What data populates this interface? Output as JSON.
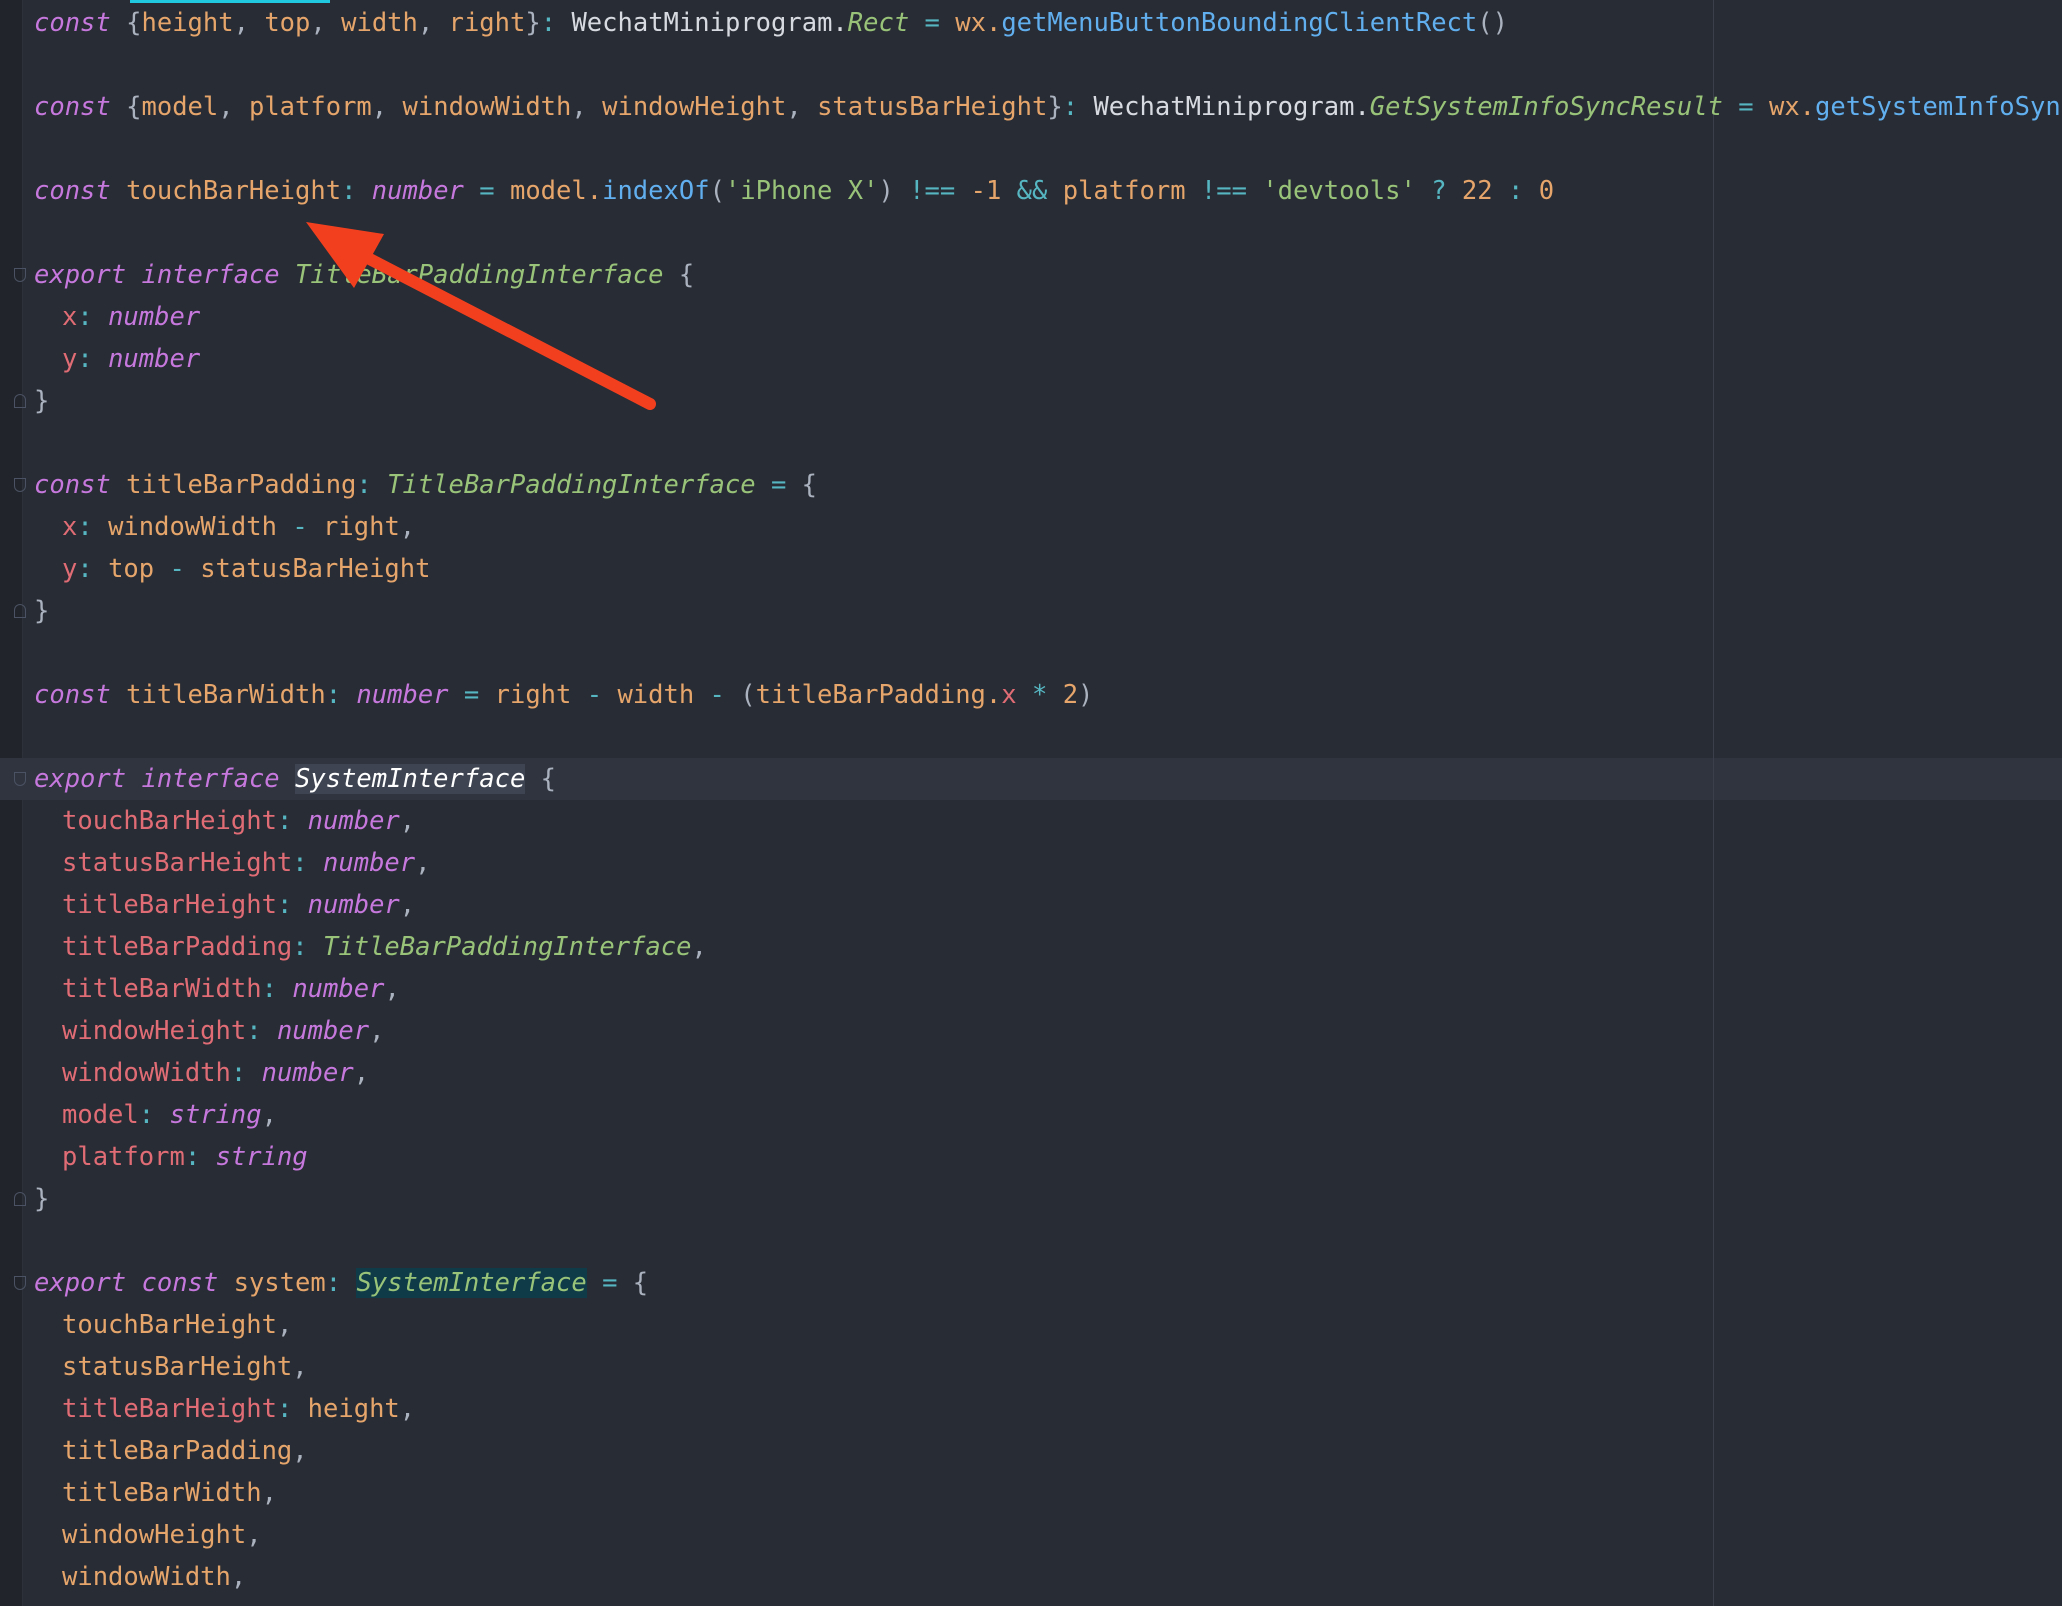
{
  "editor": {
    "colors": {
      "background": "#282c34",
      "annotation_arrow": "#f2401f",
      "scroll_tab": "#20c9e0"
    },
    "annotation_icon": "arrow-annotation-icon",
    "lines": [
      {
        "row": 0,
        "indent": 0,
        "tokens": [
          {
            "t": "const",
            "c": "kw"
          },
          {
            "t": " {",
            "c": "pun"
          },
          {
            "t": "height",
            "c": "var"
          },
          {
            "t": ", ",
            "c": "pun"
          },
          {
            "t": "top",
            "c": "var"
          },
          {
            "t": ", ",
            "c": "pun"
          },
          {
            "t": "width",
            "c": "var"
          },
          {
            "t": ", ",
            "c": "pun"
          },
          {
            "t": "right",
            "c": "var"
          },
          {
            "t": "}",
            "c": "pun"
          },
          {
            "t": ": ",
            "c": "op"
          },
          {
            "t": "WechatMiniprogram.",
            "c": "plain"
          },
          {
            "t": "Rect",
            "c": "cls"
          },
          {
            "t": " = ",
            "c": "op"
          },
          {
            "t": "wx.",
            "c": "var"
          },
          {
            "t": "getMenuButtonBoundingClientRect",
            "c": "fn"
          },
          {
            "t": "()",
            "c": "pun"
          }
        ]
      },
      {
        "row": 2,
        "indent": 0,
        "tokens": [
          {
            "t": "const",
            "c": "kw"
          },
          {
            "t": " {",
            "c": "pun"
          },
          {
            "t": "model",
            "c": "var"
          },
          {
            "t": ", ",
            "c": "pun"
          },
          {
            "t": "platform",
            "c": "var"
          },
          {
            "t": ", ",
            "c": "pun"
          },
          {
            "t": "windowWidth",
            "c": "var"
          },
          {
            "t": ", ",
            "c": "pun"
          },
          {
            "t": "windowHeight",
            "c": "var"
          },
          {
            "t": ", ",
            "c": "pun"
          },
          {
            "t": "statusBarHeight",
            "c": "var"
          },
          {
            "t": "}",
            "c": "pun"
          },
          {
            "t": ": ",
            "c": "op"
          },
          {
            "t": "WechatMiniprogram.",
            "c": "plain"
          },
          {
            "t": "GetSystemInfoSyncResult",
            "c": "cls"
          },
          {
            "t": " = ",
            "c": "op"
          },
          {
            "t": "wx.",
            "c": "var"
          },
          {
            "t": "getSystemInfoSync",
            "c": "fn"
          },
          {
            "t": "()",
            "c": "pun"
          }
        ]
      },
      {
        "row": 4,
        "indent": 0,
        "tokens": [
          {
            "t": "const",
            "c": "kw"
          },
          {
            "t": " touchBarHeight",
            "c": "var"
          },
          {
            "t": ": ",
            "c": "op"
          },
          {
            "t": "number",
            "c": "typ"
          },
          {
            "t": " = ",
            "c": "op"
          },
          {
            "t": "model.",
            "c": "var"
          },
          {
            "t": "indexOf",
            "c": "fn"
          },
          {
            "t": "(",
            "c": "pun"
          },
          {
            "t": "'iPhone X'",
            "c": "str"
          },
          {
            "t": ") ",
            "c": "pun"
          },
          {
            "t": "!==",
            "c": "op"
          },
          {
            "t": " -1 ",
            "c": "num"
          },
          {
            "t": "&&",
            "c": "op"
          },
          {
            "t": " platform ",
            "c": "var"
          },
          {
            "t": "!==",
            "c": "op"
          },
          {
            "t": " ",
            "c": "pun"
          },
          {
            "t": "'devtools'",
            "c": "str"
          },
          {
            "t": " ? ",
            "c": "op"
          },
          {
            "t": "22",
            "c": "num"
          },
          {
            "t": " : ",
            "c": "op"
          },
          {
            "t": "0",
            "c": "num"
          }
        ]
      },
      {
        "row": 6,
        "indent": 0,
        "tokens": [
          {
            "t": "export",
            "c": "kw"
          },
          {
            "t": " ",
            "c": "pun"
          },
          {
            "t": "interface",
            "c": "kw"
          },
          {
            "t": " ",
            "c": "pun"
          },
          {
            "t": "TitleBarPaddingInterface",
            "c": "cls"
          },
          {
            "t": " {",
            "c": "pun"
          }
        ]
      },
      {
        "row": 7,
        "indent": 1,
        "tokens": [
          {
            "t": "x",
            "c": "prop"
          },
          {
            "t": ": ",
            "c": "op"
          },
          {
            "t": "number",
            "c": "typ"
          }
        ]
      },
      {
        "row": 8,
        "indent": 1,
        "tokens": [
          {
            "t": "y",
            "c": "prop"
          },
          {
            "t": ": ",
            "c": "op"
          },
          {
            "t": "number",
            "c": "typ"
          }
        ]
      },
      {
        "row": 9,
        "indent": 0,
        "tokens": [
          {
            "t": "}",
            "c": "pun"
          }
        ]
      },
      {
        "row": 11,
        "indent": 0,
        "tokens": [
          {
            "t": "const",
            "c": "kw"
          },
          {
            "t": " titleBarPadding",
            "c": "var"
          },
          {
            "t": ": ",
            "c": "op"
          },
          {
            "t": "TitleBarPaddingInterface",
            "c": "cls"
          },
          {
            "t": " = ",
            "c": "op"
          },
          {
            "t": "{",
            "c": "pun"
          }
        ]
      },
      {
        "row": 12,
        "indent": 1,
        "tokens": [
          {
            "t": "x",
            "c": "prop"
          },
          {
            "t": ": ",
            "c": "op"
          },
          {
            "t": "windowWidth",
            "c": "var"
          },
          {
            "t": " - ",
            "c": "op"
          },
          {
            "t": "right",
            "c": "var"
          },
          {
            "t": ",",
            "c": "pun"
          }
        ]
      },
      {
        "row": 13,
        "indent": 1,
        "tokens": [
          {
            "t": "y",
            "c": "prop"
          },
          {
            "t": ": ",
            "c": "op"
          },
          {
            "t": "top",
            "c": "var"
          },
          {
            "t": " - ",
            "c": "op"
          },
          {
            "t": "statusBarHeight",
            "c": "var"
          }
        ]
      },
      {
        "row": 14,
        "indent": 0,
        "tokens": [
          {
            "t": "}",
            "c": "pun"
          }
        ]
      },
      {
        "row": 16,
        "indent": 0,
        "tokens": [
          {
            "t": "const",
            "c": "kw"
          },
          {
            "t": " titleBarWidth",
            "c": "var"
          },
          {
            "t": ": ",
            "c": "op"
          },
          {
            "t": "number",
            "c": "typ"
          },
          {
            "t": " = ",
            "c": "op"
          },
          {
            "t": "right",
            "c": "var"
          },
          {
            "t": " - ",
            "c": "op"
          },
          {
            "t": "width",
            "c": "var"
          },
          {
            "t": " - ",
            "c": "op"
          },
          {
            "t": "(",
            "c": "pun"
          },
          {
            "t": "titleBarPadding.",
            "c": "var"
          },
          {
            "t": "x",
            "c": "prop"
          },
          {
            "t": " * ",
            "c": "op"
          },
          {
            "t": "2",
            "c": "num"
          },
          {
            "t": ")",
            "c": "pun"
          }
        ]
      },
      {
        "row": 18,
        "indent": 0,
        "tokens": [
          {
            "t": "export",
            "c": "kw"
          },
          {
            "t": " ",
            "c": "pun"
          },
          {
            "t": "interface",
            "c": "kw"
          },
          {
            "t": " ",
            "c": "pun"
          },
          {
            "t": "SystemInterface",
            "c": "hl-sel"
          },
          {
            "t": " {",
            "c": "pun"
          }
        ]
      },
      {
        "row": 19,
        "indent": 1,
        "tokens": [
          {
            "t": "touchBarHeight",
            "c": "prop"
          },
          {
            "t": ": ",
            "c": "op"
          },
          {
            "t": "number",
            "c": "typ"
          },
          {
            "t": ",",
            "c": "pun"
          }
        ]
      },
      {
        "row": 20,
        "indent": 1,
        "tokens": [
          {
            "t": "statusBarHeight",
            "c": "prop"
          },
          {
            "t": ": ",
            "c": "op"
          },
          {
            "t": "number",
            "c": "typ"
          },
          {
            "t": ",",
            "c": "pun"
          }
        ]
      },
      {
        "row": 21,
        "indent": 1,
        "tokens": [
          {
            "t": "titleBarHeight",
            "c": "prop"
          },
          {
            "t": ": ",
            "c": "op"
          },
          {
            "t": "number",
            "c": "typ"
          },
          {
            "t": ",",
            "c": "pun"
          }
        ]
      },
      {
        "row": 22,
        "indent": 1,
        "tokens": [
          {
            "t": "titleBarPadding",
            "c": "prop"
          },
          {
            "t": ": ",
            "c": "op"
          },
          {
            "t": "TitleBarPaddingInterface",
            "c": "cls"
          },
          {
            "t": ",",
            "c": "pun"
          }
        ]
      },
      {
        "row": 23,
        "indent": 1,
        "tokens": [
          {
            "t": "titleBarWidth",
            "c": "prop"
          },
          {
            "t": ": ",
            "c": "op"
          },
          {
            "t": "number",
            "c": "typ"
          },
          {
            "t": ",",
            "c": "pun"
          }
        ]
      },
      {
        "row": 24,
        "indent": 1,
        "tokens": [
          {
            "t": "windowHeight",
            "c": "prop"
          },
          {
            "t": ": ",
            "c": "op"
          },
          {
            "t": "number",
            "c": "typ"
          },
          {
            "t": ",",
            "c": "pun"
          }
        ]
      },
      {
        "row": 25,
        "indent": 1,
        "tokens": [
          {
            "t": "windowWidth",
            "c": "prop"
          },
          {
            "t": ": ",
            "c": "op"
          },
          {
            "t": "number",
            "c": "typ"
          },
          {
            "t": ",",
            "c": "pun"
          }
        ]
      },
      {
        "row": 26,
        "indent": 1,
        "tokens": [
          {
            "t": "model",
            "c": "prop"
          },
          {
            "t": ": ",
            "c": "op"
          },
          {
            "t": "string",
            "c": "typ"
          },
          {
            "t": ",",
            "c": "pun"
          }
        ]
      },
      {
        "row": 27,
        "indent": 1,
        "tokens": [
          {
            "t": "platform",
            "c": "prop"
          },
          {
            "t": ": ",
            "c": "op"
          },
          {
            "t": "string",
            "c": "typ"
          }
        ]
      },
      {
        "row": 28,
        "indent": 0,
        "tokens": [
          {
            "t": "}",
            "c": "pun"
          }
        ]
      },
      {
        "row": 30,
        "indent": 0,
        "tokens": [
          {
            "t": "export",
            "c": "kw"
          },
          {
            "t": " ",
            "c": "pun"
          },
          {
            "t": "const",
            "c": "kw"
          },
          {
            "t": " system",
            "c": "var"
          },
          {
            "t": ": ",
            "c": "op"
          },
          {
            "t": "SystemInterface",
            "c": "hl-ref"
          },
          {
            "t": " = ",
            "c": "op"
          },
          {
            "t": "{",
            "c": "pun"
          }
        ]
      },
      {
        "row": 31,
        "indent": 1,
        "tokens": [
          {
            "t": "touchBarHeight",
            "c": "var"
          },
          {
            "t": ",",
            "c": "pun"
          }
        ]
      },
      {
        "row": 32,
        "indent": 1,
        "tokens": [
          {
            "t": "statusBarHeight",
            "c": "var"
          },
          {
            "t": ",",
            "c": "pun"
          }
        ]
      },
      {
        "row": 33,
        "indent": 1,
        "tokens": [
          {
            "t": "titleBarHeight",
            "c": "prop"
          },
          {
            "t": ": ",
            "c": "op"
          },
          {
            "t": "height",
            "c": "var"
          },
          {
            "t": ",",
            "c": "pun"
          }
        ]
      },
      {
        "row": 34,
        "indent": 1,
        "tokens": [
          {
            "t": "titleBarPadding",
            "c": "var"
          },
          {
            "t": ",",
            "c": "pun"
          }
        ]
      },
      {
        "row": 35,
        "indent": 1,
        "tokens": [
          {
            "t": "titleBarWidth",
            "c": "var"
          },
          {
            "t": ",",
            "c": "pun"
          }
        ]
      },
      {
        "row": 36,
        "indent": 1,
        "tokens": [
          {
            "t": "windowHeight",
            "c": "var"
          },
          {
            "t": ",",
            "c": "pun"
          }
        ]
      },
      {
        "row": 37,
        "indent": 1,
        "tokens": [
          {
            "t": "windowWidth",
            "c": "var"
          },
          {
            "t": ",",
            "c": "pun"
          }
        ]
      }
    ]
  }
}
